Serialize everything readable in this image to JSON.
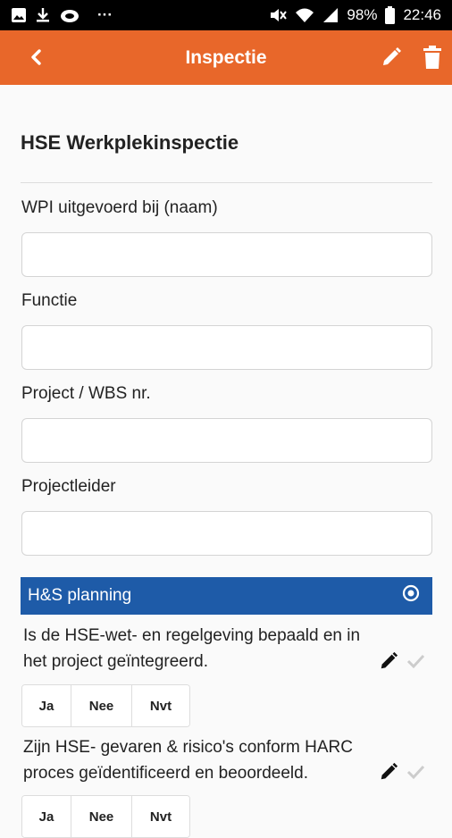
{
  "status_bar": {
    "battery": "98%",
    "time": "22:46",
    "more": "···",
    "left_icons": [
      "image-icon",
      "download-icon",
      "cloud-icon"
    ],
    "right_icons": [
      "mute-icon",
      "wifi-icon",
      "signal-icon",
      "battery-icon"
    ]
  },
  "app_bar": {
    "title": "Inspectie",
    "color": "#e8672a",
    "icons": [
      "back-chevron-icon",
      "pencil-icon",
      "trash-icon"
    ]
  },
  "form": {
    "title": "HSE Werkplekinspectie",
    "fields": [
      {
        "label": "WPI uitgevoerd bij (naam)",
        "value": ""
      },
      {
        "label": "Functie",
        "value": ""
      },
      {
        "label": "Project / WBS nr.",
        "value": ""
      },
      {
        "label": "Projectleider",
        "value": ""
      }
    ]
  },
  "section": {
    "title": "H&S planning",
    "color": "#1e5ba8",
    "icon": "radio-target-icon"
  },
  "questions": [
    {
      "line1": "Is de HSE-wet- en regelgeving bepaald en in",
      "line2": "het project geïntegreerd.",
      "options": [
        "Ja",
        "Nee",
        "Nvt"
      ]
    },
    {
      "line1": "Zijn HSE- gevaren & risico's conform HARC",
      "line2": "proces geïdentificeerd en beoordeeld.",
      "options": [
        "Ja",
        "Nee",
        "Nvt"
      ]
    }
  ]
}
